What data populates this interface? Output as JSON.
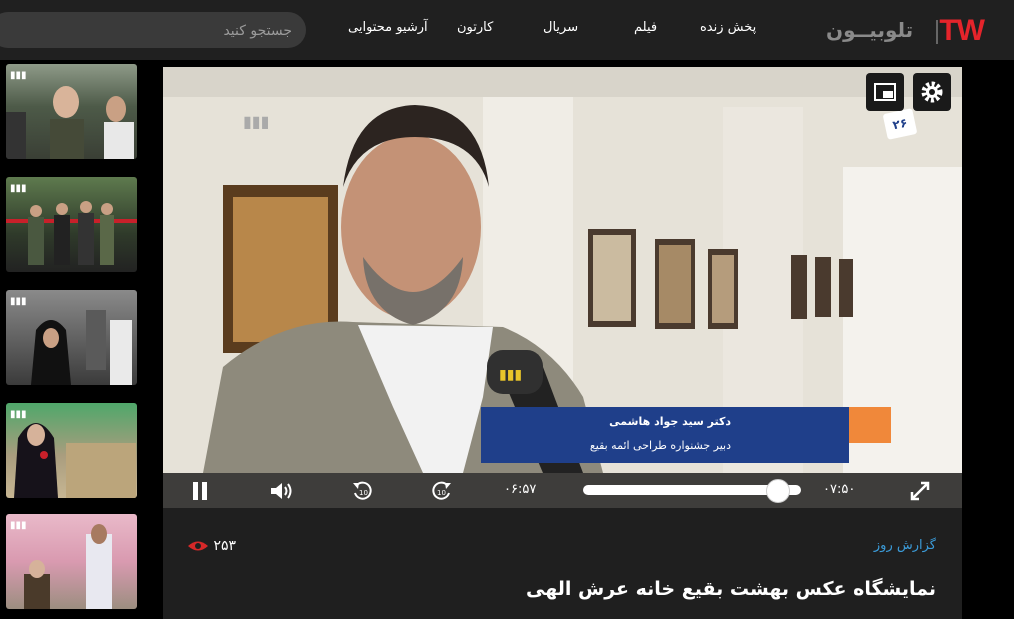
{
  "header": {
    "logo_brand": "TW",
    "logo_name": "تلوبیــون",
    "nav": [
      "پخش زنده",
      "فیلم",
      "سریال",
      "کارتون",
      "آرشیو محتوایی"
    ],
    "search_placeholder": "جستجو کنید"
  },
  "sidebar": {
    "thumbnails": [
      {
        "label": "video-thumbnail-1"
      },
      {
        "label": "video-thumbnail-2"
      },
      {
        "label": "video-thumbnail-3"
      },
      {
        "label": "video-thumbnail-4"
      },
      {
        "label": "video-thumbnail-5"
      }
    ]
  },
  "player": {
    "lower_third_name": "دکتر سید جواد هاشمی",
    "lower_third_role": "دبیر جشنواره طراحی ائمه بقیع",
    "channel_badge": "۲۶",
    "current_time": "۰۶:۵۷",
    "duration": "۰۷:۵۰",
    "progress": 0.89,
    "icons": {
      "settings": "gear-icon",
      "pip": "picture-in-picture-icon",
      "pause": "pause-icon",
      "volume": "volume-icon",
      "rewind": "rewind-10-icon",
      "forward": "forward-10-icon",
      "fullscreen": "fullscreen-icon"
    }
  },
  "info": {
    "category": "گزارش روز",
    "views": "۲۵۳",
    "title": "نمایشگاه عکس بهشت بقیع خانه عرش الهی"
  },
  "colors": {
    "brand_red": "#e5242b",
    "link_blue": "#3b9bd8",
    "lower_third_blue": "#1f3f8a",
    "lower_third_orange": "#f0883a"
  }
}
